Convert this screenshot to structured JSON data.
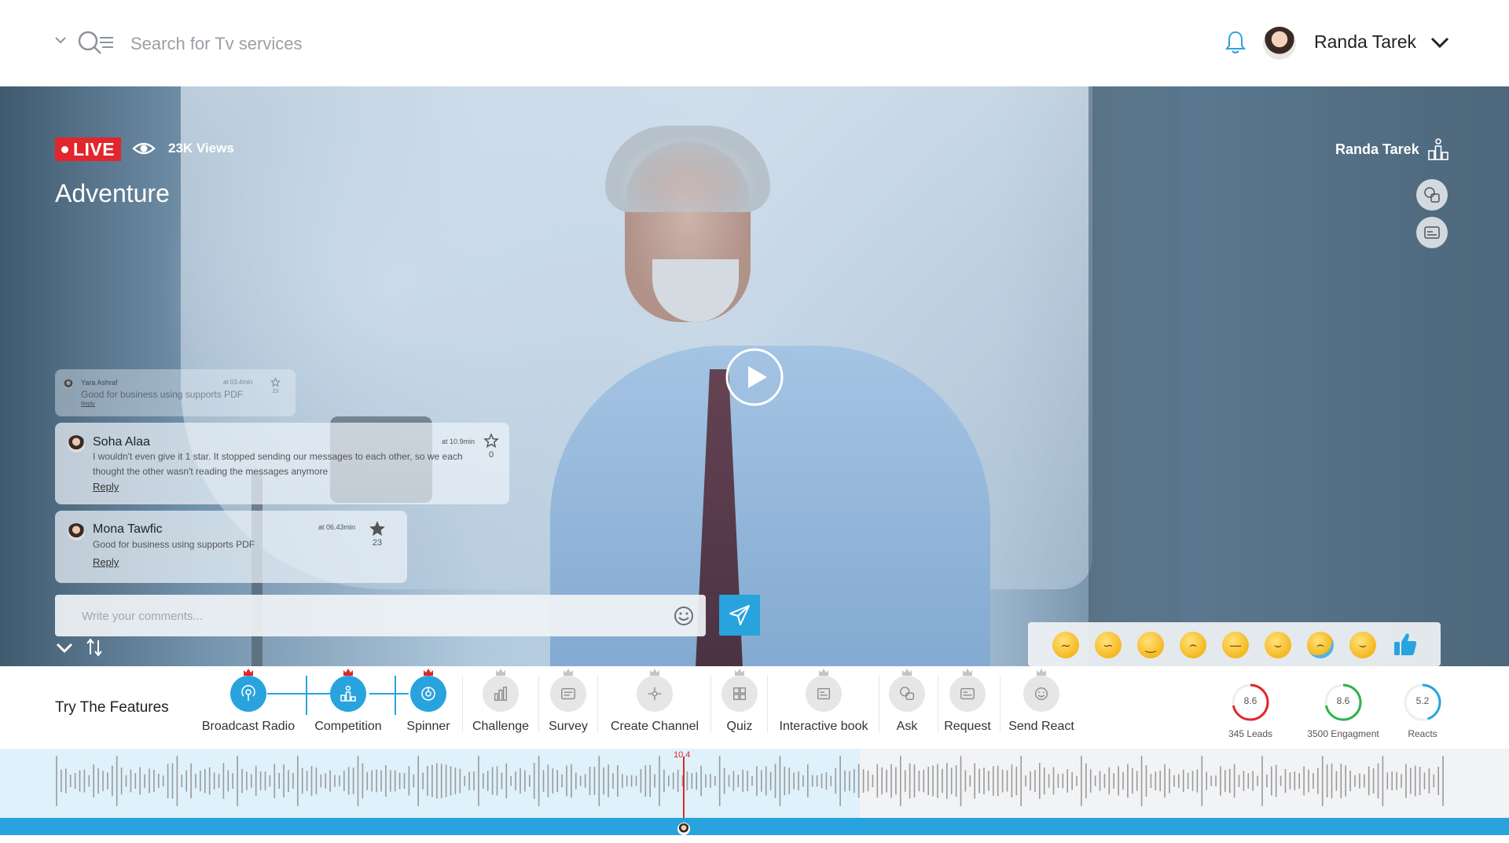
{
  "header": {
    "search_placeholder": "Search for Tv services",
    "user_name": "Randa Tarek"
  },
  "video": {
    "live_label": "LIVE",
    "views": "23K Views",
    "title": "Adventure",
    "host_name": "Randa Tarek"
  },
  "comments": [
    {
      "name": "Yara Ashraf",
      "time": "at 03.4min",
      "text": "Good for business using supports PDF",
      "reply": "Reply",
      "stars": "23"
    },
    {
      "name": "Soha Alaa",
      "time": "at 10.9min",
      "text": "I wouldn't even give it 1 star. It stopped sending our messages to each other, so we each thought the other wasn't reading the messages anymore",
      "reply": "Reply",
      "stars": "0"
    },
    {
      "name": "Mona Tawfic",
      "time": "at 06.43min",
      "text": "Good for business using supports PDF",
      "reply": "Reply",
      "stars": "23"
    }
  ],
  "comment_input": {
    "placeholder": "Write your comments..."
  },
  "reactions": [
    "confused-face",
    "crazy-face",
    "yum-face",
    "frown-face",
    "annoyed-face",
    "laughing-face",
    "crying-face",
    "smirk-face",
    "thumbs-up"
  ],
  "features": {
    "title": "Try The Features",
    "items": [
      {
        "label": "Broadcast Radio",
        "icon": "radio-icon",
        "active": true
      },
      {
        "label": "Competition",
        "icon": "competition-icon",
        "active": true
      },
      {
        "label": "Spinner",
        "icon": "spinner-icon",
        "active": true
      },
      {
        "label": "Challenge",
        "icon": "challenge-icon",
        "active": false
      },
      {
        "label": "Survey",
        "icon": "survey-icon",
        "active": false
      },
      {
        "label": "Create Channel",
        "icon": "channel-icon",
        "active": false
      },
      {
        "label": "Quiz",
        "icon": "quiz-icon",
        "active": false
      },
      {
        "label": "Interactive book",
        "icon": "book-icon",
        "active": false
      },
      {
        "label": "Ask",
        "icon": "ask-icon",
        "active": false
      },
      {
        "label": "Request",
        "icon": "request-icon",
        "active": false
      },
      {
        "label": "Send React",
        "icon": "react-icon",
        "active": false
      }
    ]
  },
  "stats": [
    {
      "value": "8.6",
      "label": "345 Leads",
      "color": "#e1262d",
      "progress": 0.72
    },
    {
      "value": "8.6",
      "label": "3500 Engagment",
      "color": "#2db34a",
      "progress": 0.72
    },
    {
      "value": "5.2",
      "label": "Reacts",
      "color": "#29a3de",
      "progress": 0.45
    }
  ],
  "timeline": {
    "marker_label": "10.4",
    "progress": 0.57,
    "colors": {
      "accent": "#29a3de",
      "marker": "#e1262d"
    }
  }
}
